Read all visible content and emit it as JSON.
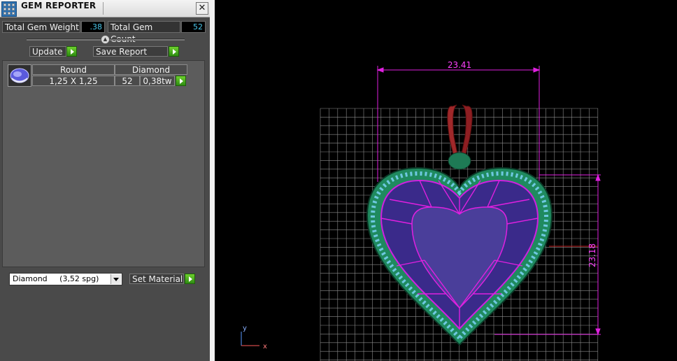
{
  "window": {
    "title": "GEM REPORTER"
  },
  "stats": {
    "weight_label": "Total Gem Weight",
    "weight_value": ".38",
    "count_label": "Total Gem Count",
    "count_value": "52"
  },
  "actions": {
    "update_label": "Update",
    "save_report_label": "Save Report"
  },
  "gem_table": {
    "headers": [
      "Round",
      "Diamond"
    ],
    "rows": [
      {
        "size": "1,25 X 1,25",
        "count": "52",
        "weight": "0,38tw"
      }
    ]
  },
  "material": {
    "selected": "Diamond     (3,52 spg)",
    "set_label": "Set Material"
  },
  "viewport": {
    "dimension_width": "23.41",
    "dimension_height": "23.18",
    "axis_y": "y",
    "axis_x": "x"
  },
  "icons": [
    "app-icon",
    "close-icon",
    "slider-knob-icon",
    "gem-round-icon",
    "dropdown-arrow-icon",
    "go-arrow-icon"
  ]
}
